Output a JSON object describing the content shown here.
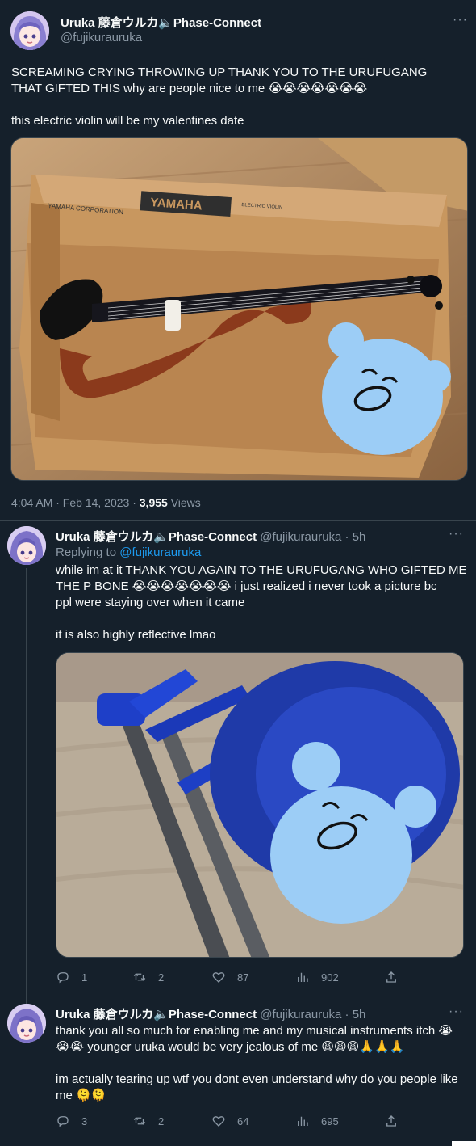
{
  "main_tweet": {
    "display_name": "Uruka 藤倉ウルカ🔈Phase-Connect",
    "handle": "@fujikurauruka",
    "text_line1": "SCREAMING CRYING THROWING UP THANK YOU TO THE URUFUGANG",
    "text_line2": "THAT GIFTED THIS why are people nice to me 😭😭😭😭😭😭😭",
    "text_line3": "this electric violin will be my valentines date",
    "timestamp": "4:04 AM · Feb 14, 2023 · ",
    "views_count": "3,955",
    "views_label": " Views",
    "image_box_text": "YAMAHA",
    "image_box_small": "ELECTRIC VIOLIN",
    "image_corp": "YAMAHA CORPORATION"
  },
  "reply1": {
    "display_name": "Uruka 藤倉ウルカ🔈Phase-Connect",
    "handle_time": "@fujikurauruka · 5h",
    "replying_prefix": "Replying to ",
    "replying_handle": "@fujikurauruka",
    "text_line1": "while im at it THANK YOU AGAIN TO THE URUFUGANG WHO GIFTED ME",
    "text_line2": "THE P BONE 😭😭😭😭😭😭😭 i just realized i never took a picture bc",
    "text_line3": "ppl were staying over when it came",
    "text_line4": "it is also highly reflective lmao",
    "replies": "1",
    "retweets": "2",
    "likes": "87",
    "views": "902"
  },
  "reply2": {
    "display_name": "Uruka 藤倉ウルカ🔈Phase-Connect",
    "handle_time": "@fujikurauruka · 5h",
    "text_line1": "thank you all so much for enabling me and my musical instruments itch 😭",
    "text_line2": "😭😭 younger uruka would be very jealous of me 😩😩😩🙏🙏🙏",
    "text_line3": "im actually tearing up wtf you dont even understand why do you people like",
    "text_line4": "me 🫠🫠",
    "replies": "3",
    "retweets": "2",
    "likes": "64",
    "views": "695"
  },
  "more_label": "···",
  "colors": {
    "background": "#15202b",
    "text": "#f7f9f9",
    "muted": "#8b98a5",
    "link": "#1d9bf0",
    "border": "#38444d"
  }
}
